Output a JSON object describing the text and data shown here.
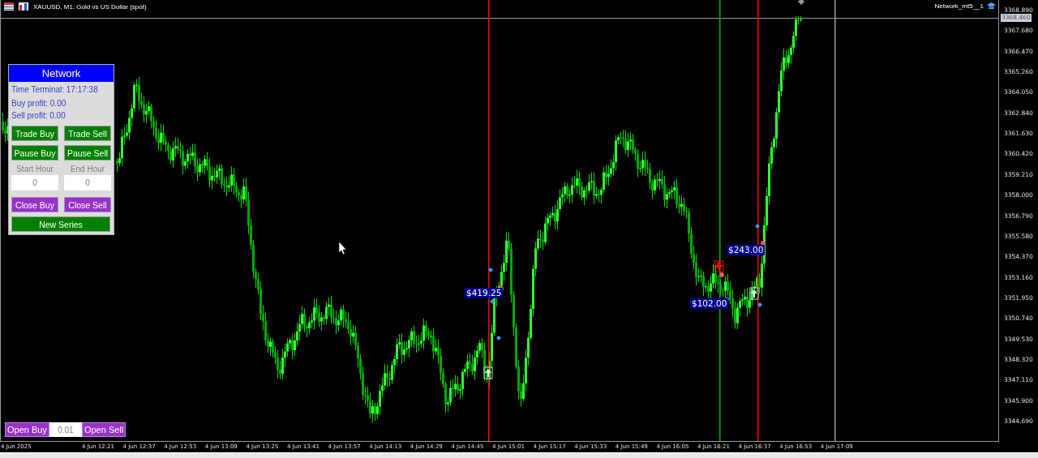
{
  "window": {
    "chart_title": "XAUUSD, M1:  Gold vs US Dollar (spot)",
    "expert_name": "Network_mt5__1"
  },
  "panel": {
    "title": "Network",
    "info": [
      "Time Terminal: 17:17:38",
      "Buy profit: 0.00",
      "Sell profit: 0.00"
    ],
    "button_rows": [
      {
        "kind": "green",
        "buttons": [
          "Trade Buy",
          "Trade Sell"
        ]
      },
      {
        "kind": "green",
        "buttons": [
          "Pause Buy",
          "Pause Sell"
        ]
      }
    ],
    "hour_labels": [
      "Start Hour",
      "End Hour"
    ],
    "hour_fields": [
      "0",
      "0"
    ],
    "close_buttons": [
      "Close Buy",
      "Close Sell"
    ],
    "new_series": "New Series"
  },
  "order_bar": {
    "buy": "Open Buy",
    "lot": "0.01",
    "sell": "Open Sell"
  },
  "trade_labels": [
    "$419.25",
    "$243.00",
    "$102.00"
  ],
  "price_axis": {
    "current_price": "3368.460",
    "ticks": [
      "3368.890",
      "3367.680",
      "3366.470",
      "3365.260",
      "3364.050",
      "3362.840",
      "3361.630",
      "3360.420",
      "3359.210",
      "3358.000",
      "3356.790",
      "3355.580",
      "3354.370",
      "3353.160",
      "3351.950",
      "3350.740",
      "3349.530",
      "3348.320",
      "3347.110",
      "3345.900",
      "3344.690"
    ]
  },
  "time_axis": {
    "labels": [
      "4 Jun 2025",
      "4 Jun 12:21",
      "4 Jun 12:37",
      "4 Jun 12:53",
      "4 Jun 13:09",
      "4 Jun 13:25",
      "4 Jun 13:41",
      "4 Jun 13:57",
      "4 Jun 14:13",
      "4 Jun 14:29",
      "4 Jun 14:45",
      "4 Jun 15:01",
      "4 Jun 15:17",
      "4 Jun 15:33",
      "4 Jun 15:49",
      "4 Jun 16:05",
      "4 Jun 16:21",
      "4 Jun 16:37",
      "4 Jun 16:53",
      "4 Jun 17:09"
    ]
  }
}
